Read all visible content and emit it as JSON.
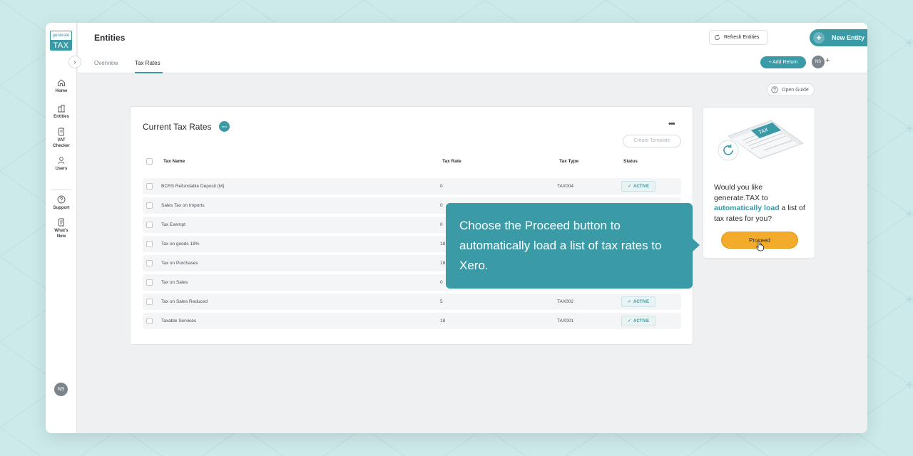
{
  "app": {
    "logo_top": "generate",
    "logo_bottom": "TAX"
  },
  "sidebar": {
    "expand_glyph": "›",
    "items": [
      {
        "label": "Home",
        "icon": "home-icon"
      },
      {
        "label": "Entities",
        "icon": "building-icon"
      },
      {
        "label": "VAT",
        "label2": "Checker",
        "icon": "document-icon"
      },
      {
        "label": "Users",
        "icon": "user-icon"
      },
      {
        "label": "Support",
        "icon": "question-icon"
      },
      {
        "label": "What's",
        "label2": "New",
        "icon": "document-icon"
      }
    ],
    "user_initials": "NS"
  },
  "header": {
    "title": "Entities",
    "tabs": [
      {
        "label": "Overview",
        "active": false
      },
      {
        "label": "Tax Rates",
        "active": true
      }
    ],
    "refresh_label": "Refresh Entities",
    "new_entity_label": "New Entity",
    "add_return_label": "+ Add Return",
    "user_initials": "NS",
    "avatar_plus": "+"
  },
  "main": {
    "open_guide_label": "Open Guide",
    "card": {
      "title": "Current Tax Rates",
      "xero_badge": "xero",
      "more_glyph": "•••",
      "create_template_label": "Create Template",
      "columns": [
        "Tax Name",
        "Tax Rate",
        "Tax Type",
        "Status"
      ],
      "rows": [
        {
          "name": "BCRS Refundable Deposit (M)",
          "rate": "0",
          "type": "TAX004",
          "status": "ACTIVE"
        },
        {
          "name": "Sales Tax on Imports",
          "rate": "0",
          "type": "",
          "status": ""
        },
        {
          "name": "Tax Exempt",
          "rate": "0",
          "type": "",
          "status": ""
        },
        {
          "name": "Tax on goods 18%",
          "rate": "18",
          "type": "",
          "status": ""
        },
        {
          "name": "Tax on Purchases",
          "rate": "18",
          "type": "",
          "status": ""
        },
        {
          "name": "Tax on Sales",
          "rate": "0",
          "type": "",
          "status": ""
        },
        {
          "name": "Tax on Sales Reduced",
          "rate": "5",
          "type": "TAX002",
          "status": "ACTIVE"
        },
        {
          "name": "Taxable Services",
          "rate": "18",
          "type": "TAX001",
          "status": "ACTIVE"
        }
      ]
    },
    "promo": {
      "text_before": "Would you like generate.TAX to ",
      "text_highlight": "automatically load",
      "text_after": " a list of tax rates for you?",
      "proceed_label": "Proceed"
    },
    "tooltip": {
      "text": "Choose the Proceed button to automatically load a list of tax rates to Xero."
    }
  },
  "colors": {
    "accent": "#3a9aa6",
    "proceed": "#f2ab2a",
    "background": "#cdeaea"
  }
}
